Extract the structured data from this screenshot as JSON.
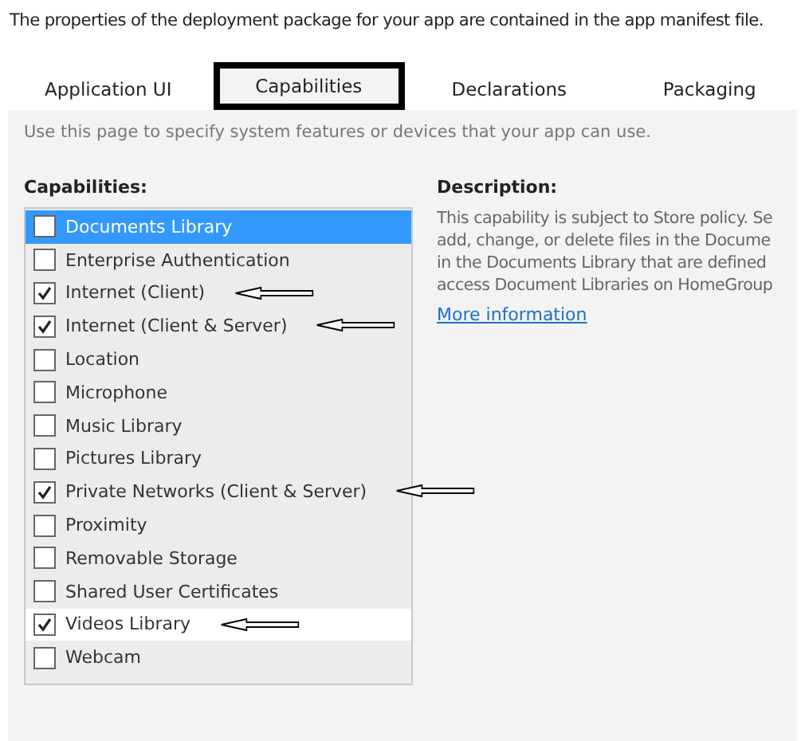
{
  "intro": "The properties of the deployment package for your app are contained in the app manifest file.",
  "tabs": [
    {
      "label": "Application UI",
      "selected": false,
      "outlined": false
    },
    {
      "label": "Capabilities",
      "selected": true,
      "outlined": true
    },
    {
      "label": "Declarations",
      "selected": false,
      "outlined": false
    },
    {
      "label": "Packaging",
      "selected": false,
      "outlined": false
    }
  ],
  "hint": "Use this page to specify system features or devices that your app can use.",
  "capabilities": {
    "heading": "Capabilities:",
    "items": [
      {
        "label": "Documents Library",
        "checked": false,
        "selected": true,
        "hovered": false,
        "arrow": false
      },
      {
        "label": "Enterprise Authentication",
        "checked": false,
        "selected": false,
        "hovered": false,
        "arrow": false
      },
      {
        "label": "Internet (Client)",
        "checked": true,
        "selected": false,
        "hovered": false,
        "arrow": true
      },
      {
        "label": "Internet (Client & Server)",
        "checked": true,
        "selected": false,
        "hovered": false,
        "arrow": true
      },
      {
        "label": "Location",
        "checked": false,
        "selected": false,
        "hovered": false,
        "arrow": false
      },
      {
        "label": "Microphone",
        "checked": false,
        "selected": false,
        "hovered": false,
        "arrow": false
      },
      {
        "label": "Music Library",
        "checked": false,
        "selected": false,
        "hovered": false,
        "arrow": false
      },
      {
        "label": "Pictures Library",
        "checked": false,
        "selected": false,
        "hovered": false,
        "arrow": false
      },
      {
        "label": "Private Networks (Client & Server)",
        "checked": true,
        "selected": false,
        "hovered": false,
        "arrow": true
      },
      {
        "label": "Proximity",
        "checked": false,
        "selected": false,
        "hovered": false,
        "arrow": false
      },
      {
        "label": "Removable Storage",
        "checked": false,
        "selected": false,
        "hovered": false,
        "arrow": false
      },
      {
        "label": "Shared User Certificates",
        "checked": false,
        "selected": false,
        "hovered": false,
        "arrow": false
      },
      {
        "label": "Videos Library",
        "checked": true,
        "selected": false,
        "hovered": true,
        "arrow": true
      },
      {
        "label": "Webcam",
        "checked": false,
        "selected": false,
        "hovered": false,
        "arrow": false
      }
    ]
  },
  "description": {
    "heading": "Description:",
    "lines": [
      "This capability is subject to Store policy. Se",
      "add, change, or delete files in the Docume",
      "in the Documents Library that are defined",
      "access Document Libraries on HomeGroup"
    ],
    "link": "More information"
  }
}
